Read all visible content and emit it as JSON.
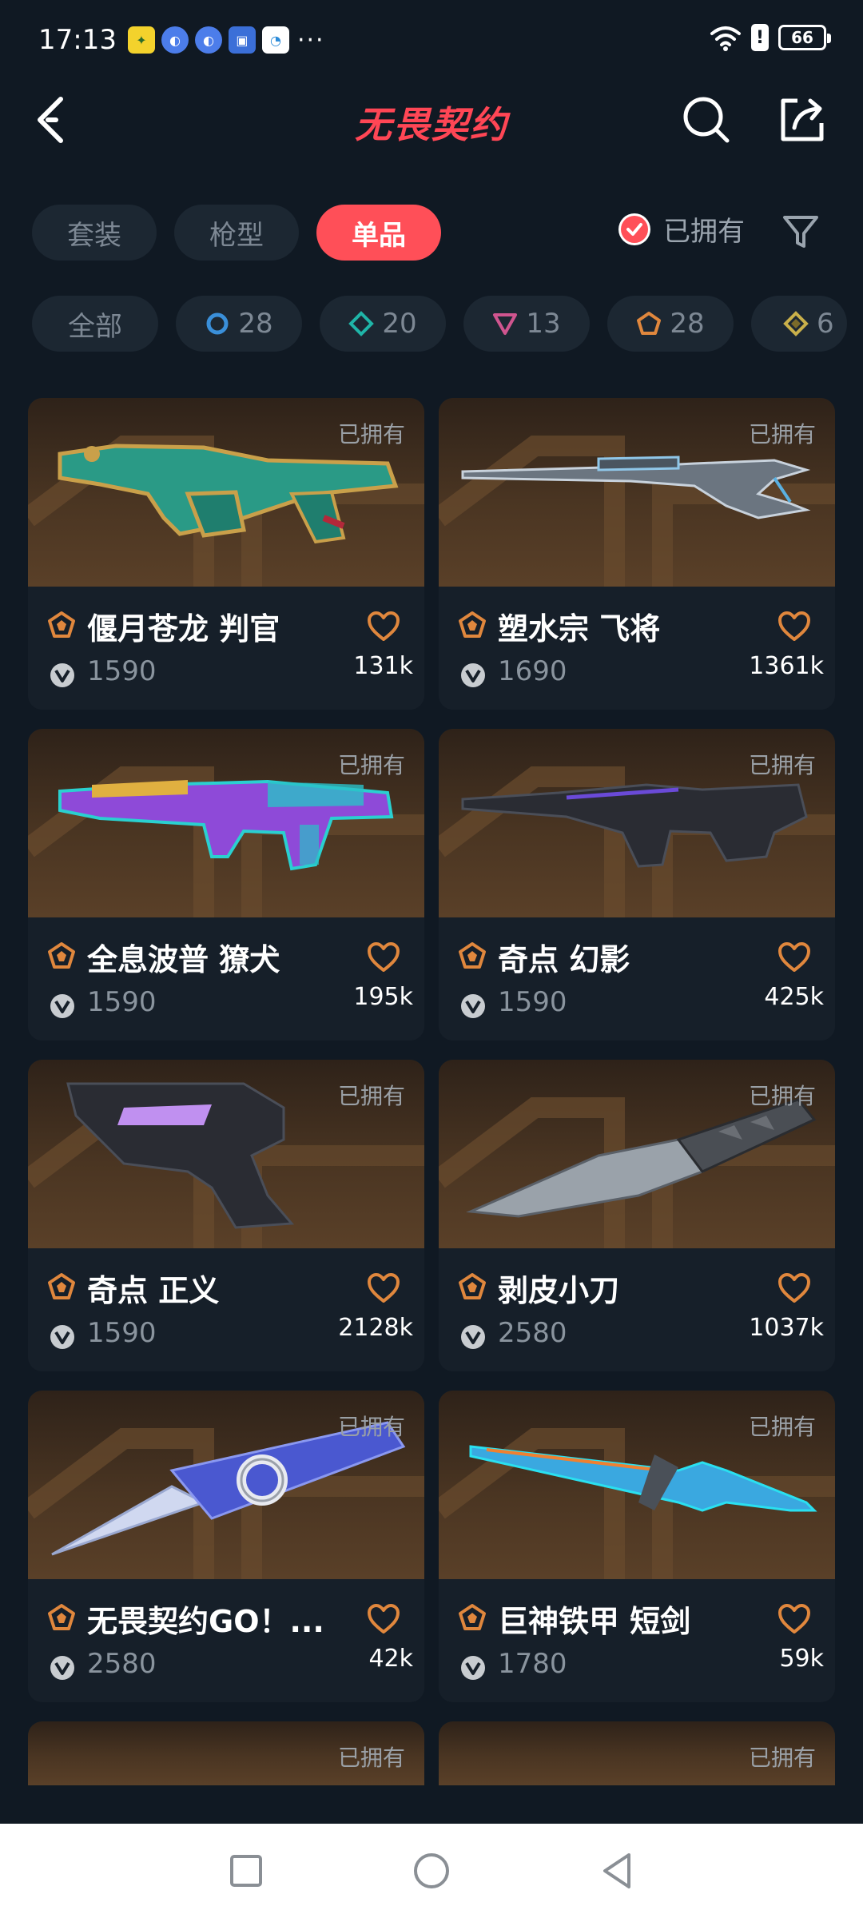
{
  "status_bar": {
    "time": "17:13",
    "dots": "···",
    "battery": "66",
    "alert": "!"
  },
  "header": {
    "title": "无畏契约"
  },
  "tabs": [
    {
      "label": "套装",
      "active": false
    },
    {
      "label": "枪型",
      "active": false
    },
    {
      "label": "单品",
      "active": true
    }
  ],
  "owned_filter": {
    "label": "已拥有",
    "checked": true
  },
  "tier_chips": [
    {
      "label": "全部"
    },
    {
      "icon": "tier-blue-ring-icon",
      "count": "28",
      "color": "#3a8fd9"
    },
    {
      "icon": "tier-teal-diamond-icon",
      "count": "20",
      "color": "#1fb5a8"
    },
    {
      "icon": "tier-purple-triangle-icon",
      "count": "13",
      "color": "#d0558f"
    },
    {
      "icon": "tier-orange-pentagon-icon",
      "count": "28",
      "color": "#e0873d"
    },
    {
      "icon": "tier-gold-diamond-icon",
      "count": "6",
      "color": "#c9b04a"
    }
  ],
  "items": [
    {
      "name": "偃月苍龙 判官",
      "price": "1590",
      "likes": "131k",
      "owned": "已拥有"
    },
    {
      "name": "塑水宗 飞将",
      "price": "1690",
      "likes": "1361k",
      "owned": "已拥有"
    },
    {
      "name": "全息波普 獠犬",
      "price": "1590",
      "likes": "195k",
      "owned": "已拥有"
    },
    {
      "name": "奇点 幻影",
      "price": "1590",
      "likes": "425k",
      "owned": "已拥有"
    },
    {
      "name": "奇点 正义",
      "price": "1590",
      "likes": "2128k",
      "owned": "已拥有"
    },
    {
      "name": "剥皮小刀",
      "price": "2580",
      "likes": "1037k",
      "owned": "已拥有"
    },
    {
      "name": "无畏契约GO！...",
      "price": "2580",
      "likes": "42k",
      "owned": "已拥有"
    },
    {
      "name": "巨神铁甲 短剑",
      "price": "1780",
      "likes": "59k",
      "owned": "已拥有"
    },
    {
      "name": "",
      "price": "",
      "likes": "",
      "owned": "已拥有"
    },
    {
      "name": "",
      "price": "",
      "likes": "",
      "owned": "已拥有"
    }
  ],
  "colors": {
    "background": "#101923",
    "accent": "#ff4f58",
    "tier_premium": "#e0873d"
  }
}
